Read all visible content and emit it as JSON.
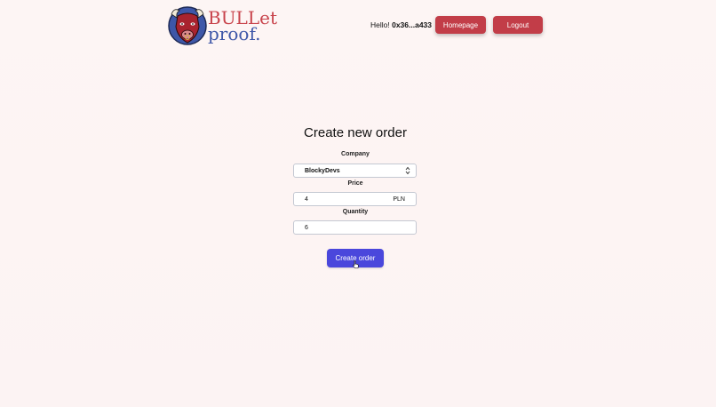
{
  "header": {
    "logo": {
      "line1": "BULLet",
      "line2": "proof.",
      "colors": {
        "line1": "#c8434b",
        "line2": "#3e57a8"
      }
    },
    "greeting_prefix": "Hello! ",
    "wallet_address": "0x36...a433",
    "nav": {
      "homepage_label": "Homepage",
      "logout_label": "Logout"
    }
  },
  "form": {
    "title": "Create new order",
    "company": {
      "label": "Company",
      "selected_value": "BlockyDevs"
    },
    "price": {
      "label": "Price",
      "value": "4",
      "unit": "PLN"
    },
    "quantity": {
      "label": "Quantity",
      "value": "6"
    },
    "submit_label": "Create order"
  },
  "icons": {
    "logo": "bull-head-icon",
    "select": "chevron-up-down-icon",
    "pointer": "hand-pointer-icon"
  },
  "colors": {
    "accent_red": "#c23d48",
    "accent_blue": "#4a47dc",
    "background": "#fdf5f4"
  }
}
